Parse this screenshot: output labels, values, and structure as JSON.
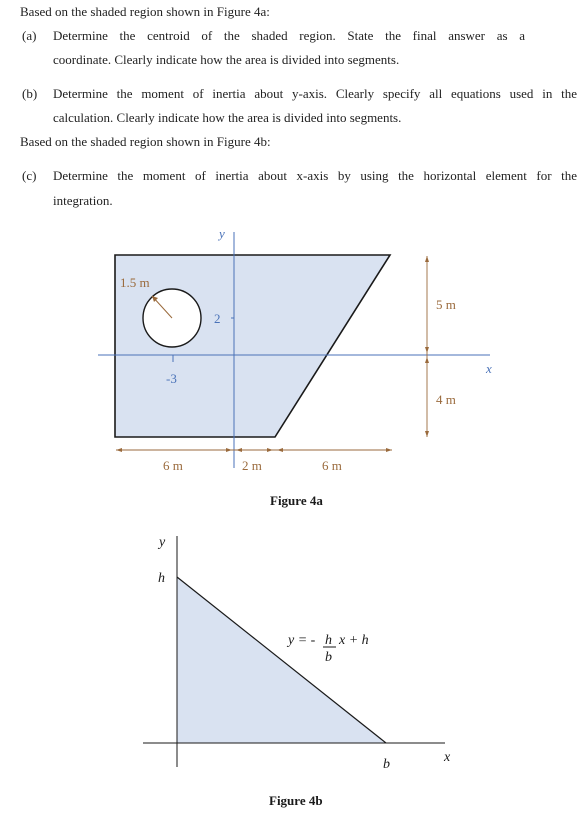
{
  "intro_4a": "Based on the shaded region shown in Figure 4a:",
  "questions": [
    {
      "label": "(a)",
      "line1": "Determine the centroid of the shaded region. State the final answer as a",
      "line2": "coordinate. Clearly indicate how the area is divided into segments."
    },
    {
      "label": "(b)",
      "line1": "Determine the moment of inertia about y-axis. Clearly specify all equations used in the",
      "line2": "calculation. Clearly indicate how the area is divided into segments."
    },
    {
      "label": "(c)",
      "line1": "Determine the moment of inertia about x-axis by using the horizontal element for the",
      "line2": "integration."
    }
  ],
  "intro_4b": "Based on the shaded region shown in Figure 4b:",
  "figure_4a": {
    "caption": "Figure 4a",
    "axis_x": "x",
    "axis_y": "y",
    "hole_radius_label": "1.5 m",
    "hole_center_y_label": "2",
    "hole_center_x_label": "-3",
    "dim_left_width": "6 m",
    "dim_mid_width": "2 m",
    "dim_right_width": "6 m",
    "dim_top_height": "5 m",
    "dim_bottom_height": "4 m",
    "fill_color": "#d9e2f1",
    "axis_color": "#4a72b8",
    "dim_color": "#9a6a3c"
  },
  "figure_4b": {
    "caption": "Figure 4b",
    "axis_x": "x",
    "axis_y": "y",
    "label_h": "h",
    "label_b": "b",
    "equation_lhs": "y = -",
    "equation_num": "h",
    "equation_den": "b",
    "equation_rhs": "x + h",
    "fill_color": "#d9e2f1"
  }
}
